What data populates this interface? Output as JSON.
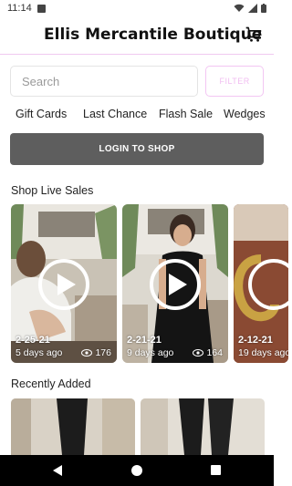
{
  "status_bar": {
    "time": "11:14"
  },
  "header": {
    "title": "Ellis Mercantile Boutique"
  },
  "search": {
    "placeholder": "Search",
    "filter_label": "FILTER"
  },
  "categories": [
    "Gift Cards",
    "Last Chance",
    "Flash Sale",
    "Wedges"
  ],
  "login": {
    "label": "LOGIN TO SHOP"
  },
  "live_sales": {
    "title": "Shop Live Sales",
    "cards": [
      {
        "date": "2-25-21",
        "ago": "5 days ago",
        "views": "176"
      },
      {
        "date": "2-21-21",
        "ago": "9 days ago",
        "views": "164"
      },
      {
        "date": "2-12-21",
        "ago": "19 days ago",
        "views": ""
      }
    ]
  },
  "recently_added": {
    "title": "Recently Added"
  },
  "colors": {
    "accent": "#f1bdf1",
    "button": "#5e5e5e",
    "nav_bar": "#000000"
  },
  "icons": [
    "cart-icon",
    "play-icon",
    "eye-icon",
    "back-icon",
    "home-icon",
    "recents-icon"
  ]
}
